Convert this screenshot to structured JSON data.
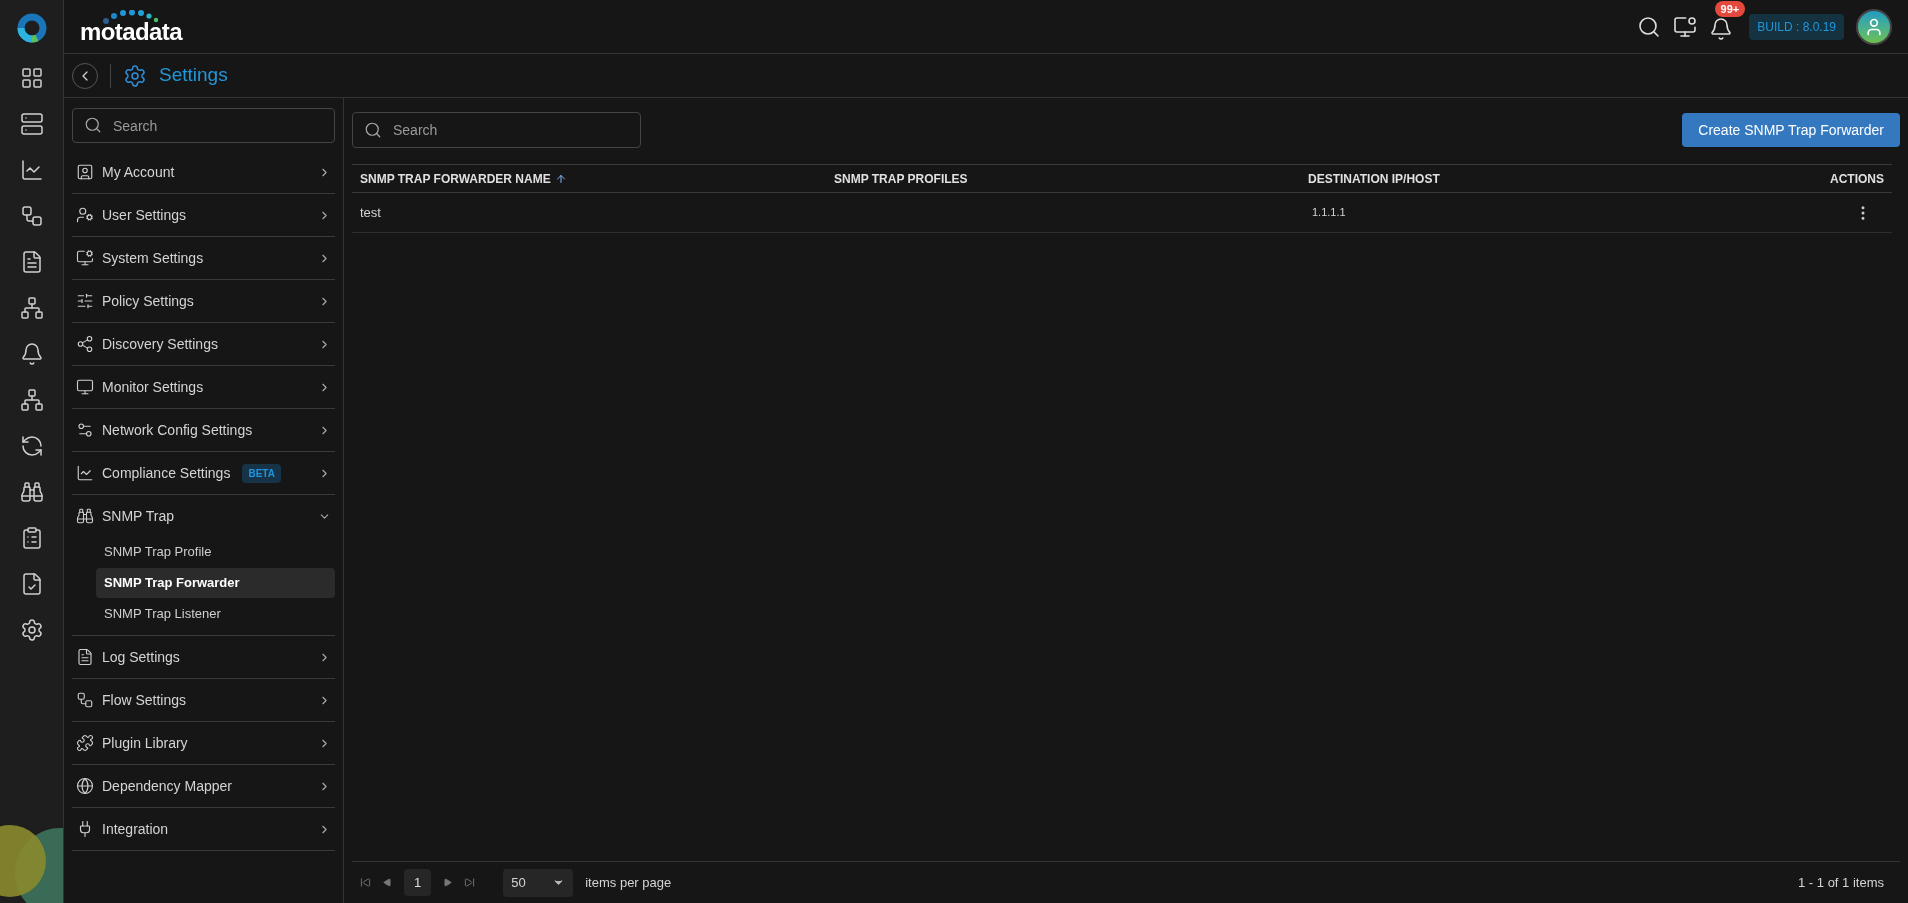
{
  "header": {
    "logo": "motadata",
    "notification_count": "99+",
    "build": "BUILD : 8.0.19"
  },
  "page": {
    "title": "Settings"
  },
  "rail": {
    "items": [
      {
        "kind": "grid"
      },
      {
        "kind": "server"
      },
      {
        "kind": "chart"
      },
      {
        "kind": "flow"
      },
      {
        "kind": "file"
      },
      {
        "kind": "network"
      },
      {
        "kind": "bell"
      },
      {
        "kind": "sitemap"
      },
      {
        "kind": "refresh"
      },
      {
        "kind": "binoculars"
      },
      {
        "kind": "report"
      },
      {
        "kind": "check"
      },
      {
        "kind": "settings"
      }
    ]
  },
  "sidebar": {
    "search": {
      "placeholder": "Search"
    },
    "items": [
      {
        "label": "My Account",
        "kind": "account",
        "expanded": false
      },
      {
        "label": "User Settings",
        "kind": "user",
        "expanded": false
      },
      {
        "label": "System Settings",
        "kind": "system",
        "expanded": false
      },
      {
        "label": "Policy Settings",
        "kind": "policy",
        "expanded": false
      },
      {
        "label": "Discovery Settings",
        "kind": "discovery",
        "expanded": false
      },
      {
        "label": "Monitor Settings",
        "kind": "monitor",
        "expanded": false
      },
      {
        "label": "Network Config Settings",
        "kind": "config",
        "expanded": false
      },
      {
        "label": "Compliance Settings",
        "kind": "chart",
        "expanded": false,
        "badge": "BETA"
      },
      {
        "label": "SNMP Trap",
        "kind": "binoculars",
        "expanded": true,
        "children": [
          {
            "label": "SNMP Trap Profile",
            "selected": false
          },
          {
            "label": "SNMP Trap Forwarder",
            "selected": true
          },
          {
            "label": "SNMP Trap Listener",
            "selected": false
          }
        ]
      },
      {
        "label": "Log Settings",
        "kind": "file",
        "expanded": false
      },
      {
        "label": "Flow Settings",
        "kind": "flow",
        "expanded": false
      },
      {
        "label": "Plugin Library",
        "kind": "plugin",
        "expanded": false
      },
      {
        "label": "Dependency Mapper",
        "kind": "globe",
        "expanded": false
      },
      {
        "label": "Integration",
        "kind": "plug",
        "expanded": false
      }
    ]
  },
  "content": {
    "search": {
      "placeholder": "Search"
    },
    "create_button": "Create SNMP Trap Forwarder",
    "table": {
      "columns": [
        {
          "label": "SNMP TRAP FORWARDER NAME",
          "sorted": true
        },
        {
          "label": "SNMP TRAP PROFILES",
          "sorted": false
        },
        {
          "label": "DESTINATION IP/HOST",
          "sorted": false
        },
        {
          "label": "ACTIONS",
          "sorted": false
        }
      ],
      "rows": [
        {
          "name": "test",
          "destination": "1.1.1.1"
        }
      ]
    },
    "pagination": {
      "page": "1",
      "page_size": "50",
      "per_page_label": "items per page",
      "summary": "1 - 1 of 1 items"
    }
  }
}
